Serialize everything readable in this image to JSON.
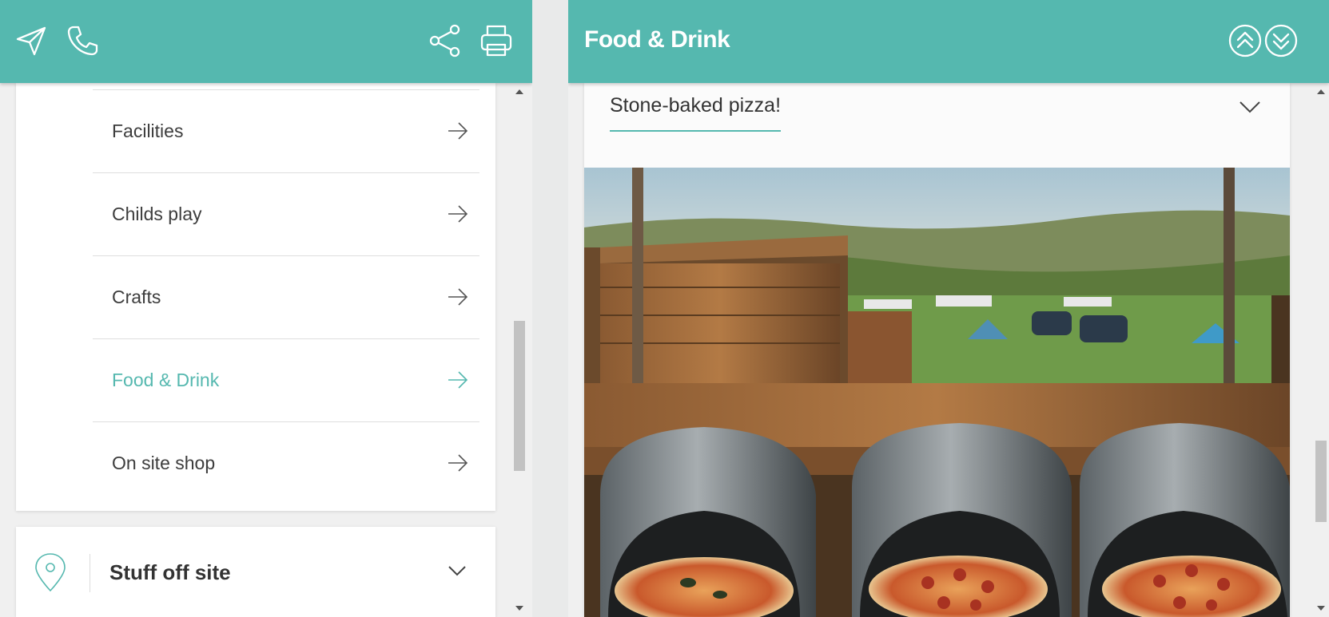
{
  "left": {
    "toolbar": {
      "send_icon": "send-icon",
      "phone_icon": "phone-icon",
      "share_icon": "share-icon",
      "print_icon": "print-icon"
    },
    "menu": [
      {
        "label": "Facilities",
        "active": false
      },
      {
        "label": "Childs play",
        "active": false
      },
      {
        "label": "Crafts",
        "active": false
      },
      {
        "label": "Food & Drink",
        "active": true
      },
      {
        "label": "On site shop",
        "active": false
      }
    ],
    "off_site": {
      "title": "Stuff off site",
      "icon": "map-pin-icon"
    }
  },
  "right": {
    "title": "Food & Drink",
    "subheading": "Stone-baked pizza!",
    "photo_alt": "Three pizza ovens with pizzas overlooking a campsite field"
  },
  "colors": {
    "accent": "#55b8af",
    "text": "#3d3d3d"
  }
}
